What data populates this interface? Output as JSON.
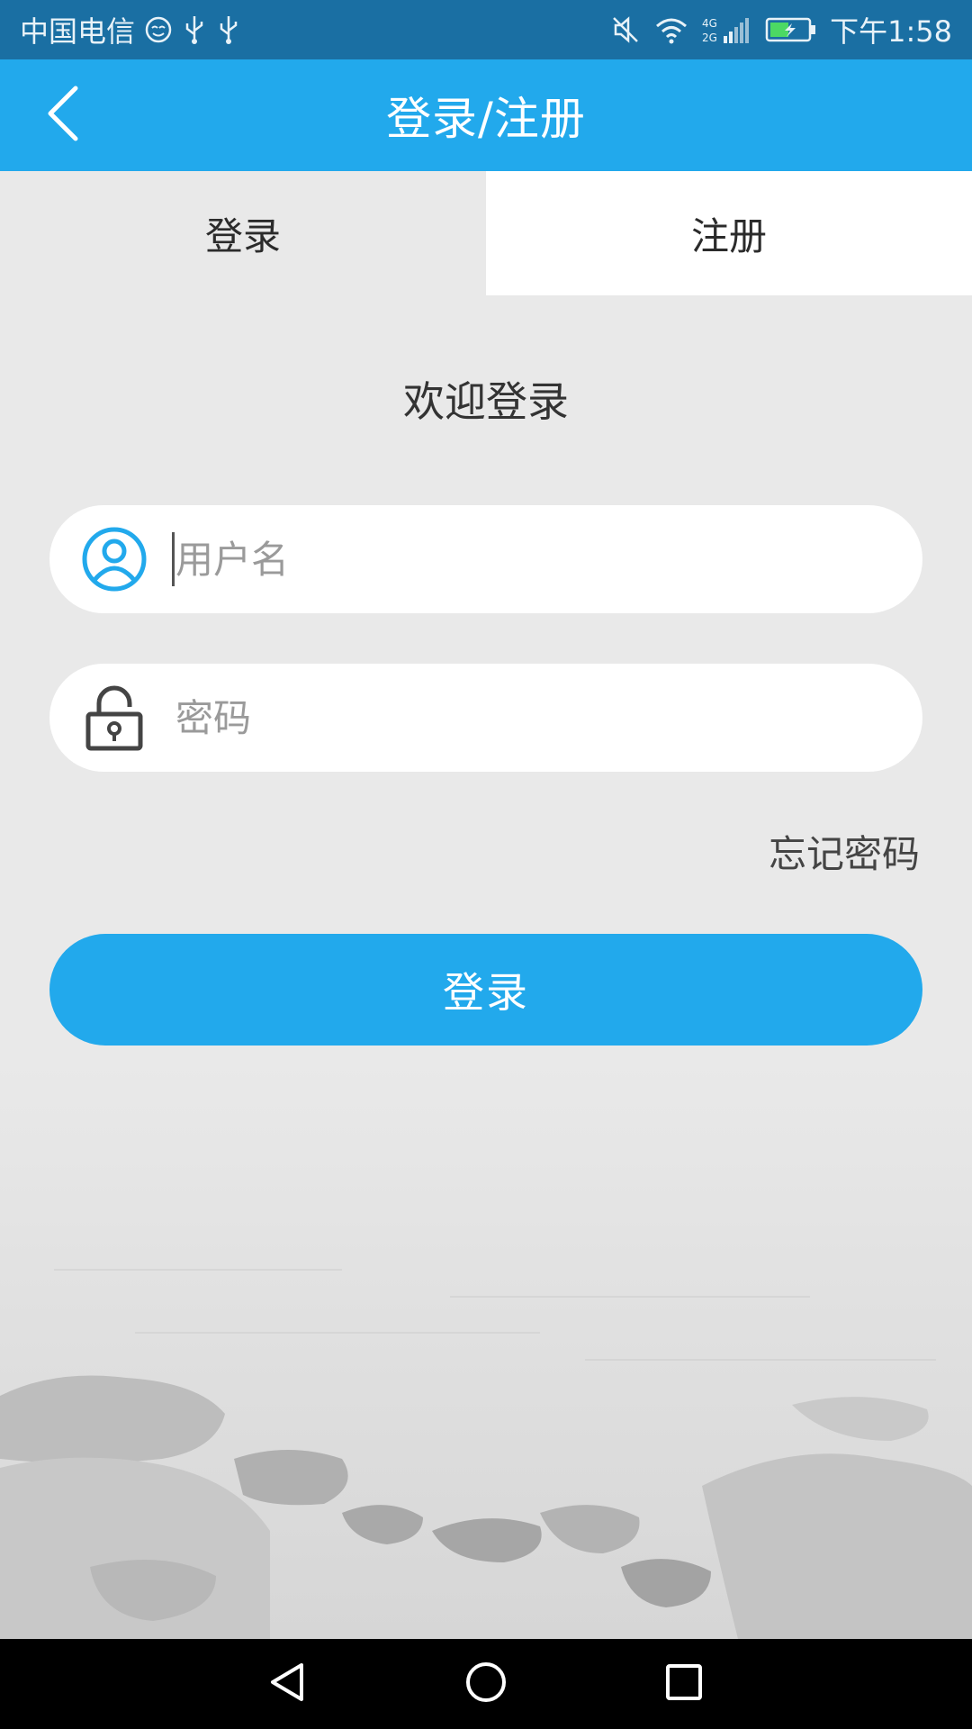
{
  "status_bar": {
    "carrier": "中国电信",
    "time": "下午1:58",
    "network": "4G 2G",
    "icons": [
      "face-icon",
      "usb-icon",
      "usb-icon",
      "mute-icon",
      "wifi-icon",
      "signal-icon",
      "battery-charging-icon"
    ]
  },
  "app_bar": {
    "title": "登录/注册",
    "back_icon": "chevron-left-icon"
  },
  "tabs": [
    {
      "label": "登录",
      "active": true
    },
    {
      "label": "注册",
      "active": false
    }
  ],
  "form": {
    "welcome": "欢迎登录",
    "username": {
      "placeholder": "用户名",
      "value": "",
      "icon": "user-circle-icon"
    },
    "password": {
      "placeholder": "密码",
      "value": "",
      "icon": "lock-icon"
    },
    "forgot_password": "忘记密码",
    "submit_label": "登录"
  },
  "nav_bar": {
    "buttons": [
      "back-triangle-icon",
      "home-circle-icon",
      "recents-square-icon"
    ]
  },
  "colors": {
    "primary": "#22a9ec",
    "status_bar": "#1a6fa3",
    "background": "#e9e9e9",
    "tab_inactive": "#ffffff",
    "text": "#333333",
    "placeholder": "#9a9a9a"
  }
}
